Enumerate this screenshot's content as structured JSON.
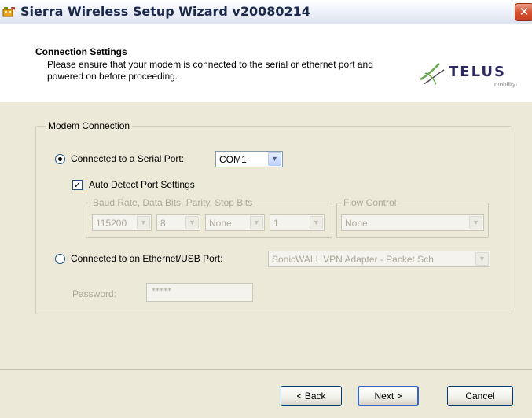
{
  "window": {
    "title": "Sierra Wireless Setup Wizard v20080214",
    "close_glyph": "✕"
  },
  "header": {
    "title": "Connection Settings",
    "description": "Please ensure that your modem is connected to the serial or ethernet port and powered on before proceeding.",
    "logo_text": "TELUS",
    "logo_sub": "mobility·"
  },
  "modem_connection": {
    "legend": "Modem Connection",
    "serial": {
      "label": "Connected to a Serial Port:",
      "selected": true,
      "port_value": "COM1"
    },
    "auto_detect": {
      "label": "Auto Detect Port Settings",
      "checked": true,
      "check_glyph": "✓"
    },
    "port_settings": {
      "legend": "Baud Rate, Data Bits, Parity, Stop Bits",
      "baud": "115200",
      "data_bits": "8",
      "parity": "None",
      "stop_bits": "1"
    },
    "flow_control": {
      "legend": "Flow Control",
      "value": "None"
    },
    "ethernet": {
      "label": "Connected to an Ethernet/USB Port:",
      "selected": false,
      "adapter_value": "SonicWALL VPN Adapter - Packet Sch"
    },
    "password": {
      "label": "Password:",
      "value": "*****"
    }
  },
  "footer": {
    "back_label": "< Back",
    "next_label": "Next >",
    "cancel_label": "Cancel"
  },
  "icons": {
    "dropdown": "▼"
  },
  "colors": {
    "dialog_bg": "#ece9d8",
    "title_text": "#1b2a4a",
    "close_button": "#d5512f",
    "telus_blue": "#2d2a63",
    "disabled_text": "#aca899"
  }
}
